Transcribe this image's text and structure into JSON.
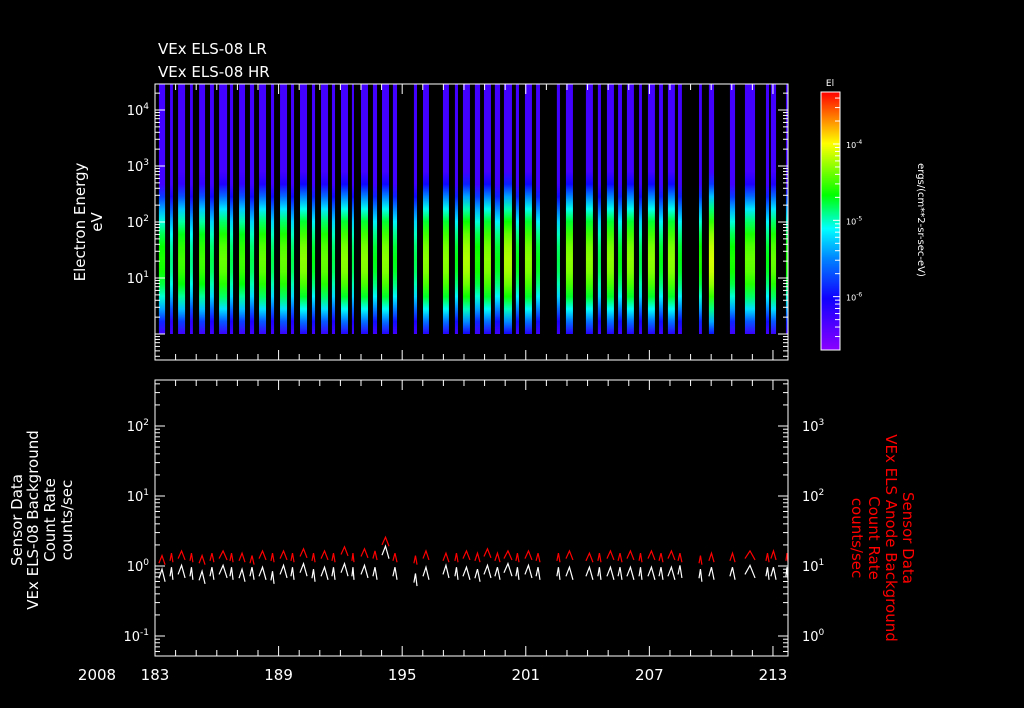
{
  "chart_data": [
    {
      "type": "heatmap",
      "titles": [
        "VEx ELS-08 LR",
        "VEx ELS-08 HR"
      ],
      "ylabel": [
        "Electron Energy",
        "eV"
      ],
      "yscale": "log",
      "ylim": [
        0.35,
        29000
      ],
      "yticks": [
        {
          "base": "10",
          "exp": "1"
        },
        {
          "base": "10",
          "exp": "2"
        },
        {
          "base": "10",
          "exp": "3"
        },
        {
          "base": "10",
          "exp": "4"
        }
      ],
      "xlim": [
        183,
        213.73
      ],
      "colorbar": {
        "title": "El",
        "label": "ergs/(cm**2-sr-sec-eV)",
        "scale": "log",
        "range": [
          2e-07,
          0.00048
        ],
        "ticks": [
          {
            "base": "10",
            "exp": "-4"
          },
          {
            "base": "10",
            "exp": "-5"
          },
          {
            "base": "10",
            "exp": "-6"
          }
        ]
      },
      "stripes_note_columns": [
        "start_day",
        "end_day",
        "peak_log_flux",
        "background_counts",
        "anode_counts"
      ],
      "stripes": [
        [
          183.19,
          183.49,
          -4.6,
          0.75,
          12
        ],
        [
          183.73,
          183.87,
          -4.9,
          0.8,
          13
        ],
        [
          184.12,
          184.46,
          -4.5,
          0.85,
          14
        ],
        [
          184.7,
          184.84,
          -4.9,
          0.8,
          13
        ],
        [
          185.14,
          185.43,
          -4.5,
          0.7,
          12
        ],
        [
          185.67,
          185.86,
          -4.8,
          0.8,
          13
        ],
        [
          186.11,
          186.5,
          -4.4,
          0.85,
          14
        ],
        [
          186.64,
          186.79,
          -4.8,
          0.8,
          13
        ],
        [
          187.08,
          187.37,
          -4.5,
          0.75,
          13
        ],
        [
          187.61,
          187.81,
          -4.8,
          0.8,
          12
        ],
        [
          188.05,
          188.39,
          -4.4,
          0.8,
          14
        ],
        [
          188.63,
          188.78,
          -4.8,
          0.7,
          13
        ],
        [
          189.07,
          189.41,
          -4.4,
          0.85,
          14
        ],
        [
          189.6,
          189.75,
          -4.8,
          0.8,
          13
        ],
        [
          190.04,
          190.38,
          -4.3,
          0.9,
          15
        ],
        [
          190.62,
          190.77,
          -4.7,
          0.75,
          13
        ],
        [
          191.06,
          191.4,
          -4.4,
          0.8,
          14
        ],
        [
          191.59,
          191.74,
          -4.8,
          0.8,
          13
        ],
        [
          192.03,
          192.37,
          -4.3,
          0.9,
          16
        ],
        [
          192.56,
          192.66,
          -4.8,
          0.8,
          13
        ],
        [
          193.0,
          193.34,
          -4.3,
          0.85,
          15
        ],
        [
          193.58,
          193.78,
          -4.7,
          0.8,
          14
        ],
        [
          194.02,
          194.36,
          -4.3,
          1.6,
          22
        ],
        [
          194.55,
          194.75,
          -4.7,
          0.8,
          13
        ],
        [
          195.57,
          195.72,
          -4.8,
          0.65,
          12
        ],
        [
          196.01,
          196.3,
          -4.3,
          0.8,
          14
        ],
        [
          196.98,
          197.27,
          -4.3,
          0.85,
          13
        ],
        [
          197.56,
          197.71,
          -4.7,
          0.8,
          13
        ],
        [
          197.95,
          198.29,
          -4.2,
          0.8,
          14
        ],
        [
          198.53,
          198.78,
          -4.6,
          0.75,
          13
        ],
        [
          198.97,
          199.31,
          -4.3,
          0.85,
          15
        ],
        [
          199.5,
          199.75,
          -4.7,
          0.8,
          13
        ],
        [
          199.94,
          200.33,
          -4.2,
          0.9,
          14
        ],
        [
          200.52,
          200.67,
          -4.7,
          0.8,
          13
        ],
        [
          200.96,
          201.3,
          -4.3,
          0.85,
          14
        ],
        [
          201.5,
          201.69,
          -4.7,
          0.8,
          13
        ],
        [
          202.51,
          202.66,
          -4.8,
          0.8,
          13
        ],
        [
          202.95,
          203.29,
          -4.3,
          0.8,
          14
        ],
        [
          203.92,
          204.26,
          -4.3,
          0.8,
          13
        ],
        [
          204.5,
          204.65,
          -4.8,
          0.8,
          13
        ],
        [
          204.94,
          205.28,
          -4.3,
          0.8,
          14
        ],
        [
          205.48,
          205.67,
          -4.7,
          0.8,
          13
        ],
        [
          205.91,
          206.25,
          -4.3,
          0.8,
          14
        ],
        [
          206.5,
          206.64,
          -4.8,
          0.8,
          13
        ],
        [
          206.93,
          207.27,
          -4.3,
          0.8,
          14
        ],
        [
          207.47,
          207.66,
          -4.7,
          0.8,
          13
        ],
        [
          207.9,
          208.24,
          -4.3,
          0.8,
          14
        ],
        [
          208.39,
          208.58,
          -4.7,
          0.85,
          13
        ],
        [
          209.41,
          209.55,
          -4.6,
          0.75,
          12
        ],
        [
          209.89,
          210.14,
          -4.1,
          0.8,
          13
        ],
        [
          210.91,
          211.16,
          -4.6,
          0.8,
          13
        ],
        [
          211.64,
          212.13,
          -4.4,
          0.85,
          14
        ],
        [
          212.66,
          212.81,
          -4.7,
          0.8,
          13
        ],
        [
          212.9,
          213.15,
          -4.4,
          0.8,
          14
        ],
        [
          213.63,
          213.73,
          -4.6,
          0.8,
          13
        ]
      ]
    },
    {
      "type": "line",
      "ylabel_left": [
        "Sensor Data",
        "VEx ELS-08 Background",
        "Count Rate",
        "counts/sec"
      ],
      "ylabel_right": [
        "Sensor Data",
        "VEx ELS Anode Background",
        "Count Rate",
        "counts/sec"
      ],
      "yscale": "log",
      "ylim_left": [
        0.051,
        460
      ],
      "ylim_right": [
        0.51,
        4600
      ],
      "yticks_left": [
        {
          "base": "10",
          "exp": "-1"
        },
        {
          "base": "10",
          "exp": "0"
        },
        {
          "base": "10",
          "exp": "1"
        },
        {
          "base": "10",
          "exp": "2"
        }
      ],
      "yticks_right": [
        {
          "base": "10",
          "exp": "0"
        },
        {
          "base": "10",
          "exp": "1"
        },
        {
          "base": "10",
          "exp": "2"
        },
        {
          "base": "10",
          "exp": "3"
        }
      ],
      "series": [
        {
          "name": "VEx ELS-08 Background",
          "color": "#ffffff",
          "axis": "left"
        },
        {
          "name": "VEx ELS Anode Background",
          "color": "#ff0000",
          "axis": "right"
        }
      ],
      "year": "2008",
      "xticks": [
        "183",
        "189",
        "195",
        "201",
        "207",
        "213"
      ],
      "xlim": [
        183,
        213.73
      ]
    }
  ]
}
